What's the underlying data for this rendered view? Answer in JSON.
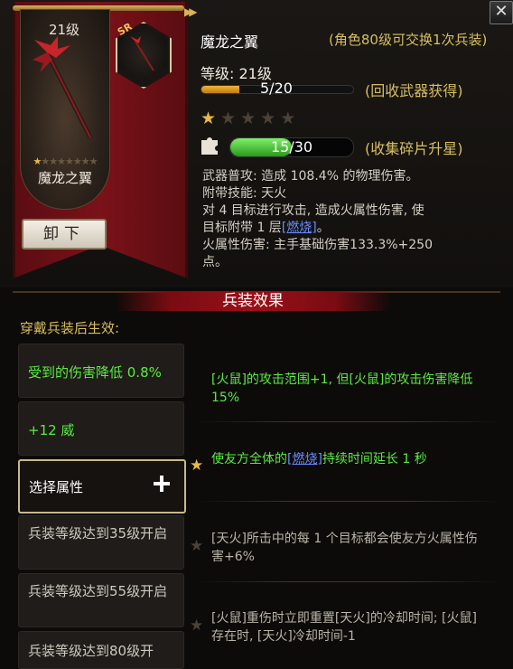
{
  "top": {
    "level_label": "21级",
    "weapon_name": "魔龙之翼",
    "exchange_note": "(角色80级可交换1次兵装)",
    "grade_label": "等级: 21级",
    "exp_text": "5/20",
    "exp_progress": 0.25,
    "exp_hint": "(回收武器获得)",
    "stars_total": 5,
    "stars_lit": 1,
    "shard_text": "15/30",
    "shard_progress": 0.5,
    "shard_hint": "(收集碎片升星)",
    "unequip_label": "卸下",
    "rarity_badge": "SR",
    "close_label": "✕"
  },
  "description": {
    "line1": "武器普攻: 造成 108.4% 的物理伤害。",
    "line2": "附带技能: 天火",
    "line3": "对 4 目标进行攻击, 造成火属性伤害, 使",
    "line4a": "目标附带 1 层",
    "line4_burn": "[燃烧]",
    "line4b": "。",
    "line5": "火属性伤害: 主手基础伤害133.3%+250",
    "line6": "点。"
  },
  "effects": {
    "section_title": "兵装效果",
    "header": "穿戴兵装后生效:",
    "slots": [
      "受到的伤害降低 0.8%",
      "+12 威",
      "选择属性",
      "兵装等级达到35级开启",
      "兵装等级达到55级开启",
      "兵装等级达到80级开"
    ],
    "right": [
      {
        "text": "[火鼠]的攻击范围+1, 但[火鼠]的攻击伤害降低15%"
      },
      {
        "pre": "使友方全体的",
        "burn": "[燃烧]",
        "post": "持续时间延长 1 秒"
      },
      {
        "text": "[天火]所击中的每 1 个目标都会使友方火属性伤害+6%"
      },
      {
        "text": "[火鼠]重伤时立即重置[天火]的冷却时间; [火鼠]存在时, [天火]冷却时间-1"
      }
    ]
  },
  "colors": {
    "gold_text": "#d7bf62",
    "green_text": "#5bea44",
    "banner_red": "#7a1218",
    "burn_link": "#6a8cff"
  }
}
